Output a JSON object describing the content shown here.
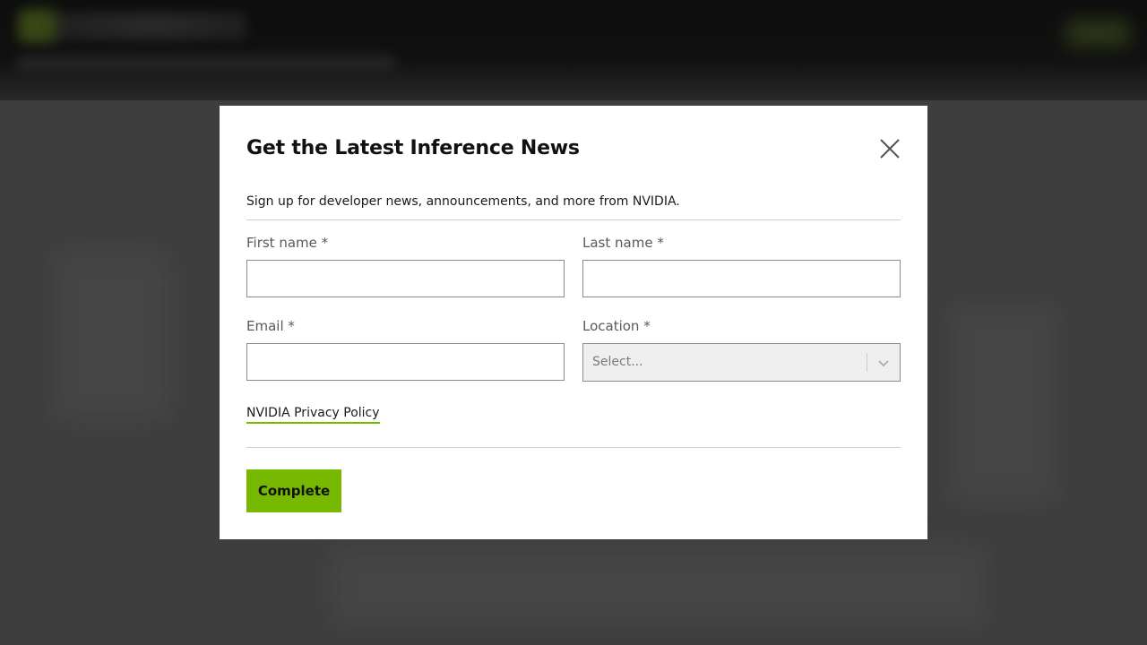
{
  "modal": {
    "title": "Get the Latest Inference News",
    "subtitle": "Sign up for developer news, announcements, and more from NVIDIA.",
    "close_icon": "close-icon",
    "fields": {
      "first_name": {
        "label": "First name *",
        "value": "",
        "placeholder": ""
      },
      "last_name": {
        "label": "Last name *",
        "value": "",
        "placeholder": ""
      },
      "email": {
        "label": "Email *",
        "value": "",
        "placeholder": ""
      },
      "location": {
        "label": "Location *",
        "selected": "Select...",
        "icon": "chevron-down-icon"
      }
    },
    "privacy_link": "NVIDIA Privacy Policy",
    "submit_label": "Complete"
  },
  "colors": {
    "accent": "#76b900",
    "modal_background": "#ffffff",
    "overlay": "#4a4a4a"
  }
}
